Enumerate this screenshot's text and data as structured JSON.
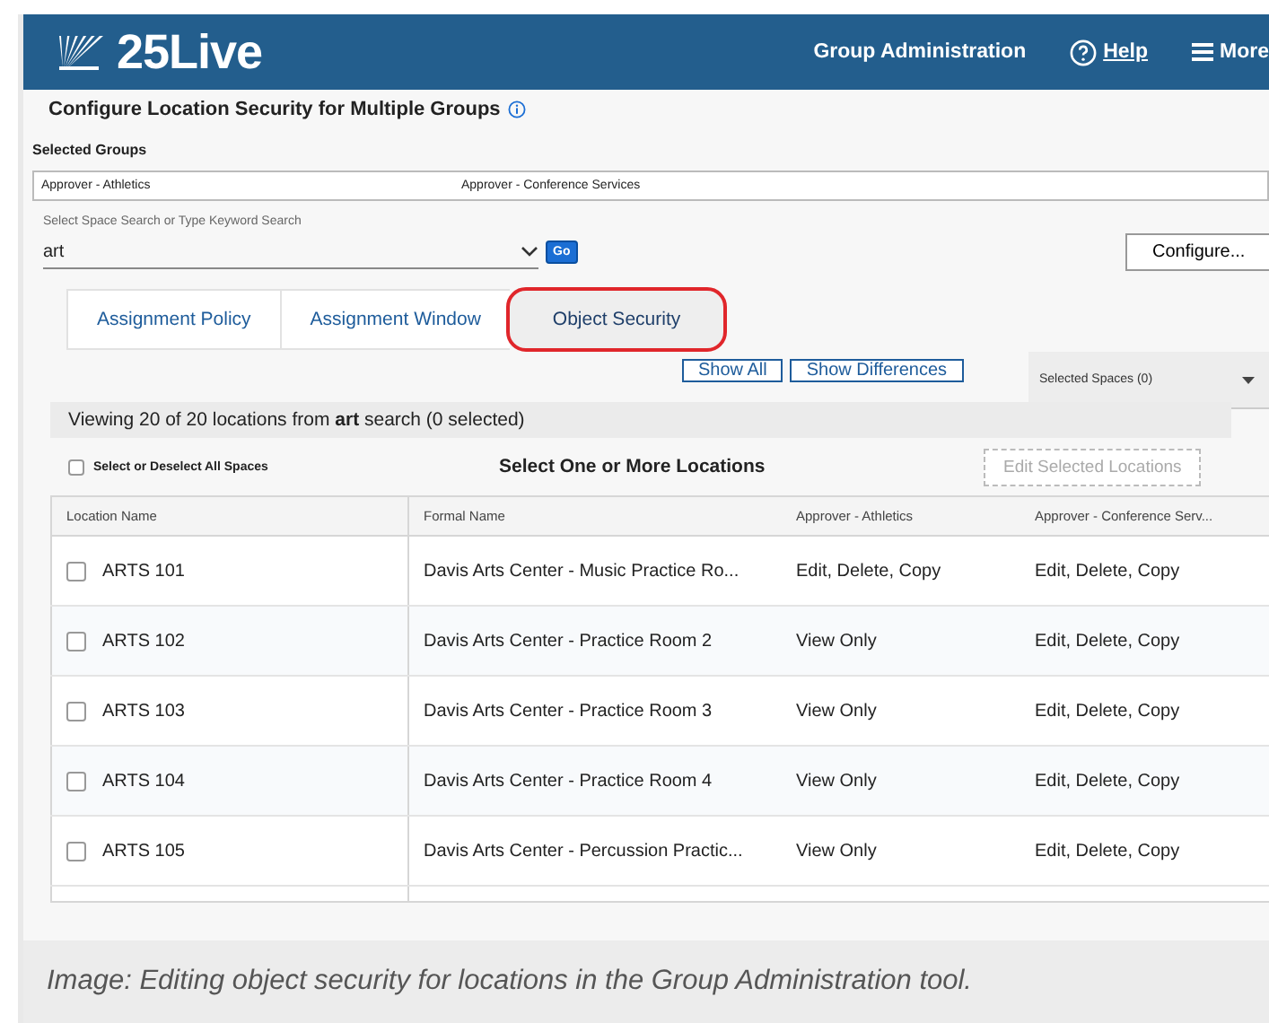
{
  "header": {
    "logo": "25Live",
    "nav": [
      {
        "label": "Group Administration",
        "kind": "text"
      },
      {
        "label": "Help",
        "kind": "help"
      },
      {
        "label": "More",
        "kind": "menu"
      }
    ]
  },
  "title": "Configure Location Security for Multiple Groups",
  "selected_groups": {
    "label": "Selected Groups",
    "groups": [
      "Approver - Athletics",
      "Approver - Conference Services"
    ]
  },
  "search": {
    "label": "Select Space Search or Type Keyword Search",
    "value": "art",
    "go": "Go",
    "configure": "Configure..."
  },
  "tabs": [
    {
      "label": "Assignment Policy",
      "selected": false,
      "highlighted": false
    },
    {
      "label": "Assignment Window",
      "selected": false,
      "highlighted": false
    },
    {
      "label": "Object Security",
      "selected": true,
      "highlighted": true
    }
  ],
  "filters": [
    "Show All",
    "Show Differences"
  ],
  "selected_spaces": "Selected Spaces (0)",
  "viewing": "Viewing 20 of 20 locations from **art** search (0 selected)",
  "select_all": {
    "label": "Select or Deselect All Spaces",
    "checked": false
  },
  "section_title": "Select One or More Locations",
  "edit_selected": {
    "label": "Edit Selected Locations",
    "disabled": true
  },
  "table": {
    "columns": [
      "Location Name",
      "Formal Name",
      "Approver - Athletics",
      "Approver - Conference Serv..."
    ],
    "rows": [
      {
        "checked": false,
        "cells": [
          "ARTS 101",
          "Davis Arts Center - Music Practice Ro...",
          "Edit, Delete, Copy",
          "Edit, Delete, Copy"
        ]
      },
      {
        "checked": false,
        "cells": [
          "ARTS 102",
          "Davis Arts Center - Practice Room 2",
          "View Only",
          "Edit, Delete, Copy"
        ]
      },
      {
        "checked": false,
        "cells": [
          "ARTS 103",
          "Davis Arts Center - Practice Room 3",
          "View Only",
          "Edit, Delete, Copy"
        ]
      },
      {
        "checked": false,
        "cells": [
          "ARTS 104",
          "Davis Arts Center - Practice Room 4",
          "View Only",
          "Edit, Delete, Copy"
        ]
      },
      {
        "checked": false,
        "cells": [
          "ARTS 105",
          "Davis Arts Center - Percussion Practic...",
          "View Only",
          "Edit, Delete, Copy"
        ]
      }
    ]
  },
  "caption": "Image: Editing object security for locations in the Group Administration tool."
}
